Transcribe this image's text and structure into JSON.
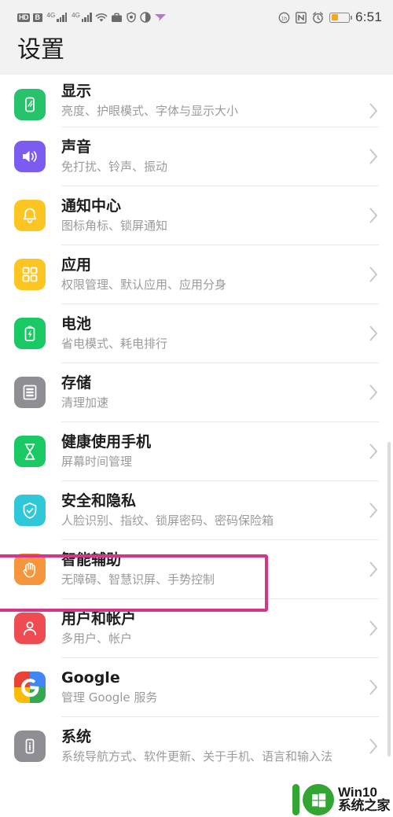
{
  "status_bar": {
    "left_icons": [
      "hd-voice-icon",
      "sim-b-icon",
      "signal-4g-1-icon",
      "signal-4g-2-icon",
      "wifi-icon",
      "work-profile-icon",
      "shield-icon",
      "dark-mode-icon",
      "send-icon"
    ],
    "hd_label": "HD",
    "sim_label": "B",
    "network_label_1": "4G",
    "network_label_2": "4G",
    "right_icons": [
      "data-saver-icon",
      "nfc-icon",
      "alarm-icon",
      "battery-icon"
    ],
    "time": "6:51",
    "battery_level_percent": 38
  },
  "header": {
    "title": "设置"
  },
  "colors": {
    "page_bg": "#ffffff",
    "chrome_bg": "#f2f2f2",
    "divider": "#e8e8e8",
    "title_text": "#1d1d1d",
    "subtitle_text": "#9b9b9b",
    "chevron": "#c8c8c8",
    "highlight_border": "#d6358a",
    "scrollbar": "#dcdcdc",
    "watermark_green": "#33a532"
  },
  "settings_list": [
    {
      "id": "display",
      "title": "显示",
      "subtitle": "亮度、护眼模式、字体与显示大小",
      "icon": "display-icon",
      "icon_bg": "#26c36a",
      "highlighted": false
    },
    {
      "id": "sound",
      "title": "声音",
      "subtitle": "免打扰、铃声、振动",
      "icon": "speaker-icon",
      "icon_bg": "#7b5bf0",
      "highlighted": false
    },
    {
      "id": "notification-center",
      "title": "通知中心",
      "subtitle": "图标角标、锁屏通知",
      "icon": "bell-icon",
      "icon_bg": "#fcc521",
      "highlighted": false
    },
    {
      "id": "apps",
      "title": "应用",
      "subtitle": "权限管理、默认应用、应用分身",
      "icon": "grid-apps-icon",
      "icon_bg": "#fcc521",
      "highlighted": false
    },
    {
      "id": "battery",
      "title": "电池",
      "subtitle": "省电模式、耗电排行",
      "icon": "battery-charge-icon",
      "icon_bg": "#18c964",
      "highlighted": false
    },
    {
      "id": "storage",
      "title": "存储",
      "subtitle": "清理加速",
      "icon": "storage-icon",
      "icon_bg": "#8e8e93",
      "highlighted": false
    },
    {
      "id": "digital-balance",
      "title": "健康使用手机",
      "subtitle": "屏幕时间管理",
      "icon": "hourglass-icon",
      "icon_bg": "#18c964",
      "highlighted": false
    },
    {
      "id": "security-privacy",
      "title": "安全和隐私",
      "subtitle": "人脸识别、指纹、锁屏密码、密码保险箱",
      "icon": "shield-check-icon",
      "icon_bg": "#2ec8d8",
      "highlighted": false
    },
    {
      "id": "smart-assistance",
      "title": "智能辅助",
      "subtitle": "无障碍、智慧识屏、手势控制",
      "icon": "hand-icon",
      "icon_bg": "#f5963c",
      "highlighted": true
    },
    {
      "id": "users-accounts",
      "title": "用户和帐户",
      "subtitle": "多用户、帐户",
      "icon": "person-icon",
      "icon_bg": "#ef4b52",
      "highlighted": false
    },
    {
      "id": "google",
      "title": "Google",
      "subtitle": "管理 Google 服务",
      "icon": "google-g-icon",
      "icon_bg": "#ffffff",
      "highlighted": false
    },
    {
      "id": "system",
      "title": "系统",
      "subtitle": "系统导航方式、软件更新、关于手机、语言和输入法",
      "icon": "info-phone-icon",
      "icon_bg": "#8e8e93",
      "highlighted": false
    }
  ],
  "chevron_glyph": "›",
  "watermark": {
    "line1": "Win10",
    "line2": "系统之家",
    "logo": "win10-home-logo"
  }
}
